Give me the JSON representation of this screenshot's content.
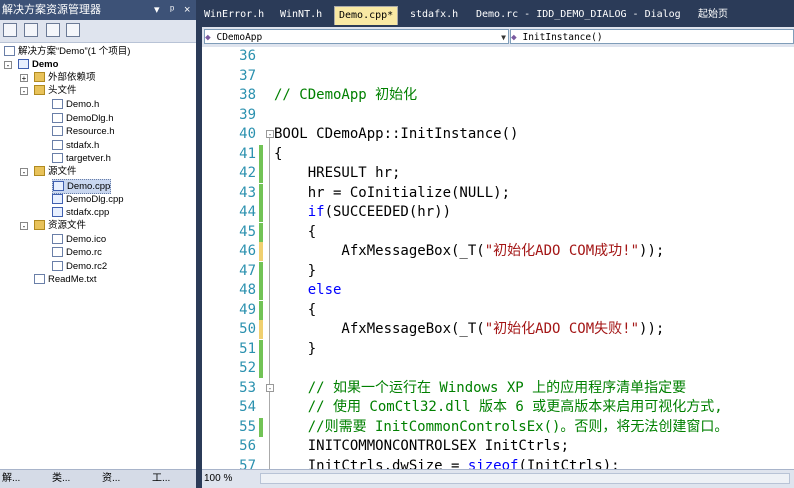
{
  "solution_explorer": {
    "title": "解决方案资源管理器",
    "title_buttons": [
      "▾",
      "ᵖ",
      "×"
    ],
    "tree": [
      {
        "label": "解决方案“Demo”(1 个项目)",
        "type": "solution"
      },
      {
        "label": "Demo",
        "type": "project"
      },
      {
        "label": "外部依赖项",
        "type": "folder"
      },
      {
        "label": "头文件",
        "type": "folder"
      },
      {
        "label": "Demo.h",
        "type": "file"
      },
      {
        "label": "DemoDlg.h",
        "type": "file"
      },
      {
        "label": "Resource.h",
        "type": "file"
      },
      {
        "label": "stdafx.h",
        "type": "file"
      },
      {
        "label": "targetver.h",
        "type": "file"
      },
      {
        "label": "源文件",
        "type": "folder"
      },
      {
        "label": "Demo.cpp",
        "type": "cpp"
      },
      {
        "label": "DemoDlg.cpp",
        "type": "cpp"
      },
      {
        "label": "stdafx.cpp",
        "type": "cpp"
      },
      {
        "label": "资源文件",
        "type": "folder"
      },
      {
        "label": "Demo.ico",
        "type": "file"
      },
      {
        "label": "Demo.rc",
        "type": "file"
      },
      {
        "label": "Demo.rc2",
        "type": "file"
      },
      {
        "label": "ReadMe.txt",
        "type": "file"
      }
    ],
    "bottom_tabs": [
      "解...",
      "类...",
      "资...",
      "工..."
    ]
  },
  "tabs": [
    "WinError.h",
    "WinNT.h",
    "Demo.cpp*",
    "stdafx.h",
    "Demo.rc - IDD_DEMO_DIALOG - Dialog",
    "起始页"
  ],
  "active_tab": "Demo.cpp*",
  "class_combo": "CDemoApp",
  "member_combo": "InitInstance()",
  "code_lines": [
    {
      "n": "36",
      "text": ""
    },
    {
      "n": "37",
      "text": ""
    },
    {
      "n": "38",
      "text": "// CDemoApp 初始化"
    },
    {
      "n": "39",
      "text": ""
    },
    {
      "n": "40",
      "text": "BOOL CDemoApp::InitInstance()"
    },
    {
      "n": "41",
      "text": "{"
    },
    {
      "n": "42",
      "text": "    HRESULT hr;"
    },
    {
      "n": "43",
      "text": "    hr = CoInitialize(NULL);"
    },
    {
      "n": "44",
      "text": "    if(SUCCEEDED(hr))"
    },
    {
      "n": "45",
      "text": "    {"
    },
    {
      "n": "46",
      "text": "        AfxMessageBox(_T(\"初始化ADO COM成功!\"));"
    },
    {
      "n": "47",
      "text": "    }"
    },
    {
      "n": "48",
      "text": "    else"
    },
    {
      "n": "49",
      "text": "    {"
    },
    {
      "n": "50",
      "text": "        AfxMessageBox(_T(\"初始化ADO COM失败!\"));"
    },
    {
      "n": "51",
      "text": "    }"
    },
    {
      "n": "52",
      "text": ""
    },
    {
      "n": "53",
      "text": "    // 如果一个运行在 Windows XP 上的应用程序清单指定要"
    },
    {
      "n": "54",
      "text": "    // 使用 ComCtl32.dll 版本 6 或更高版本来启用可视化方式,"
    },
    {
      "n": "55",
      "text": "    //则需要 InitCommonControlsEx()。否则，将无法创建窗口。"
    },
    {
      "n": "56",
      "text": "    INITCOMMONCONTROLSEX InitCtrls;"
    },
    {
      "n": "57",
      "text": "    InitCtrls.dwSize = sizeof(InitCtrls);"
    }
  ],
  "zoom": "100 %",
  "cursor_glyph": "I"
}
